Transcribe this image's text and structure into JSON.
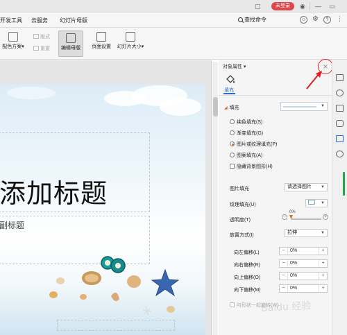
{
  "titlebar": {
    "login_label": "未登录"
  },
  "menu": {
    "items": [
      "开发工具",
      "云服务",
      "幻灯片母版"
    ],
    "search_command": "查找命令"
  },
  "ribbon": {
    "color_scheme": "配色方案",
    "color_scheme_caret": "▾",
    "layout_disabled": "版式",
    "overwrite_disabled": "重置",
    "edit_master": "编辑母版",
    "page_setup": "页面设置",
    "slide_size": "幻灯片大小",
    "slide_size_caret": "▾"
  },
  "slide": {
    "title_text": "添加标题",
    "subtitle_text": "副标题"
  },
  "panel": {
    "title": "对象属性",
    "title_caret": "▾",
    "tab_fill": "填充",
    "section_fill": "填充",
    "close_glyph": "×",
    "fill_options": [
      {
        "label": "纯色填充(S)",
        "selected": false
      },
      {
        "label": "渐变填充(G)",
        "selected": false
      },
      {
        "label": "图片或纹理填充(P)",
        "selected": true
      },
      {
        "label": "图案填充(A)",
        "selected": false
      }
    ],
    "hide_bg_graphics": "隐藏背景图形(H)",
    "picture_fill_label": "图片填充",
    "picture_fill_value": "请选择图片",
    "texture_fill_label": "纹理填充(U)",
    "transparency_label": "透明度(T)",
    "transparency_value": "0%",
    "transparency_fraction": 0.0,
    "placement_label": "放置方式(I)",
    "placement_value": "拉伸",
    "offsets": [
      {
        "label": "向左偏移(L)",
        "value": "0%"
      },
      {
        "label": "向右偏移(R)",
        "value": "0%"
      },
      {
        "label": "向上偏移(O)",
        "value": "0%"
      },
      {
        "label": "向下偏移(M)",
        "value": "0%"
      }
    ],
    "rotate_with_shape": "与形状一起旋转(W)"
  },
  "watermark": "Baidu 经验",
  "colors": {
    "accent": "#2c6fd1",
    "login": "#e0454a",
    "highlight": "#e02020",
    "selected_radio": "#e07020"
  }
}
